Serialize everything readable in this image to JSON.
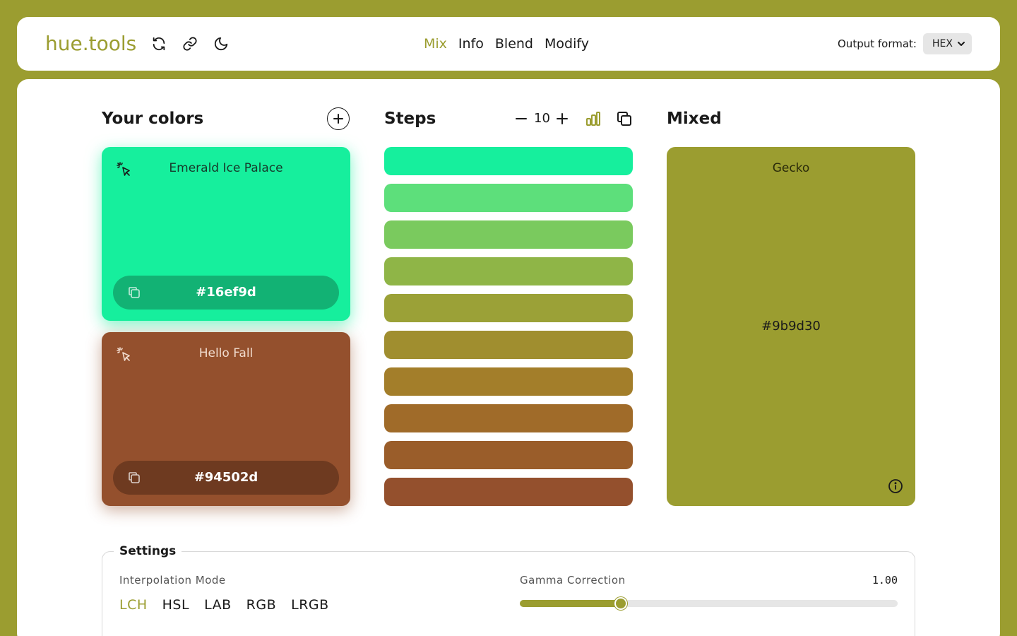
{
  "app": {
    "logo": "hue.tools",
    "accent_color": "#9b9d30",
    "header_icons": [
      "refresh-icon",
      "link-icon",
      "moon-icon"
    ]
  },
  "nav": {
    "items": [
      {
        "label": "Mix",
        "active": true
      },
      {
        "label": "Info",
        "active": false
      },
      {
        "label": "Blend",
        "active": false
      },
      {
        "label": "Modify",
        "active": false
      }
    ]
  },
  "output_format": {
    "label": "Output format:",
    "selected": "HEX"
  },
  "your_colors": {
    "title": "Your colors",
    "colors": [
      {
        "name": "Emerald Ice Palace",
        "hex": "#16ef9d"
      },
      {
        "name": "Hello Fall",
        "hex": "#94502d"
      }
    ]
  },
  "steps": {
    "title": "Steps",
    "count": "10",
    "colors": [
      "#16ef9d",
      "#5ddf7b",
      "#7aca5e",
      "#8fb547",
      "#9ba137",
      "#a08e2f",
      "#a37e2a",
      "#a06b29",
      "#9a5d2a",
      "#94502d"
    ]
  },
  "mixed": {
    "title": "Mixed",
    "name": "Gecko",
    "hex": "#9b9d30"
  },
  "settings": {
    "title": "Settings",
    "interpolation_label": "Interpolation Mode",
    "modes": [
      {
        "label": "LCH",
        "active": true
      },
      {
        "label": "HSL",
        "active": false
      },
      {
        "label": "LAB",
        "active": false
      },
      {
        "label": "RGB",
        "active": false
      },
      {
        "label": "LRGB",
        "active": false
      }
    ],
    "gamma_label": "Gamma Correction",
    "gamma_value": "1.00",
    "gamma_fraction": 0.267
  }
}
